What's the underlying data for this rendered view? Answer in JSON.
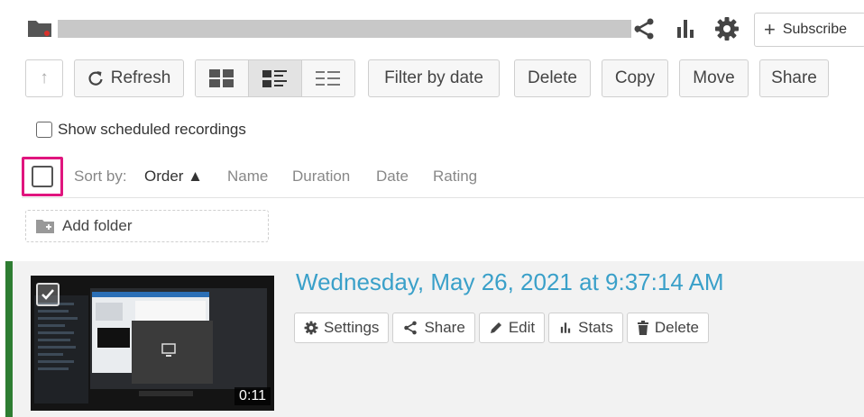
{
  "header": {
    "title_separator": ".",
    "subscribe_label": "Subscribe",
    "subscribe_prefix": "+"
  },
  "toolbar": {
    "up_label": "↑",
    "refresh_label": "Refresh",
    "filter_label": "Filter by date",
    "delete_label": "Delete",
    "copy_label": "Copy",
    "move_label": "Move",
    "share_label": "Share"
  },
  "options": {
    "show_scheduled_label": "Show scheduled recordings"
  },
  "sort": {
    "label": "Sort by:",
    "options": [
      "Order ▲",
      "Name",
      "Duration",
      "Date",
      "Rating"
    ]
  },
  "folders": {
    "add_folder_label": "Add folder"
  },
  "recording": {
    "title": "Wednesday, May 26, 2021 at 9:37:14 AM",
    "duration": "0:11",
    "actions": {
      "settings": "Settings",
      "share": "Share",
      "edit": "Edit",
      "stats": "Stats",
      "delete": "Delete"
    }
  },
  "colors": {
    "accent_link": "#3aa0c9",
    "highlight_frame": "#e0157e",
    "row_marker": "#2e7d32"
  }
}
